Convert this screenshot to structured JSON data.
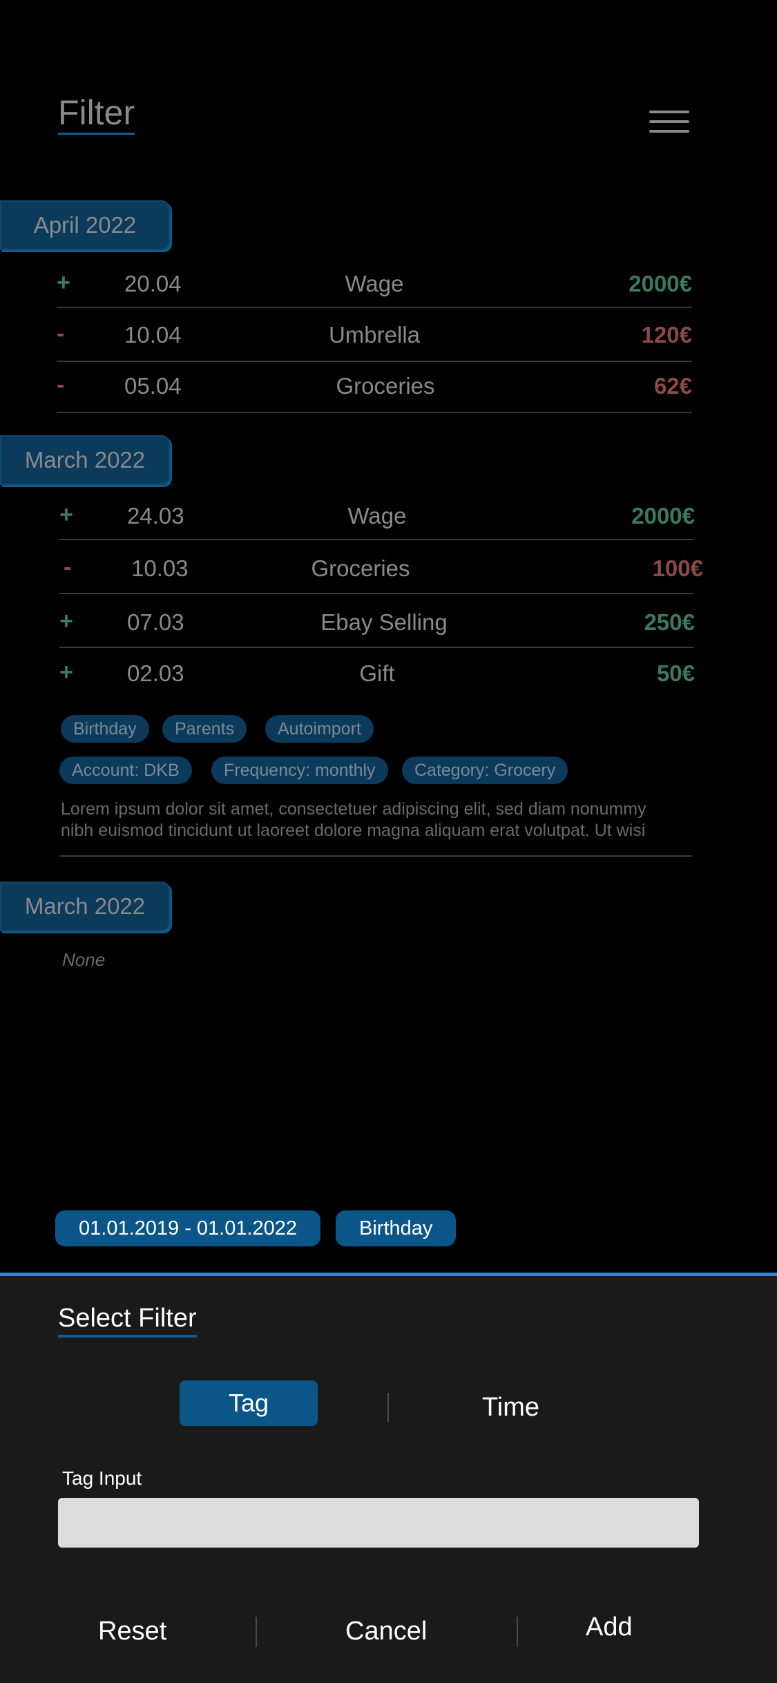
{
  "header": {
    "title": "Filter",
    "menu_icon": "hamburger-menu-icon"
  },
  "months": [
    {
      "label": "April 2022",
      "transactions": [
        {
          "sign": "+",
          "date": "20.04",
          "label": "Wage",
          "amount": "2000€",
          "type": "income"
        },
        {
          "sign": "-",
          "date": "10.04",
          "label": "Umbrella",
          "amount": "120€",
          "type": "expense"
        },
        {
          "sign": "-",
          "date": "05.04",
          "label": "Groceries",
          "amount": "62€",
          "type": "expense"
        }
      ]
    },
    {
      "label": "March 2022",
      "transactions": [
        {
          "sign": "+",
          "date": "24.03",
          "label": "Wage",
          "amount": "2000€",
          "type": "income"
        },
        {
          "sign": "-",
          "date": "10.03",
          "label": "Groceries",
          "amount": "100€",
          "type": "expense"
        },
        {
          "sign": "+",
          "date": "07.03",
          "label": "Ebay Selling",
          "amount": "250€",
          "type": "income"
        },
        {
          "sign": "+",
          "date": "02.03",
          "label": "Gift",
          "amount": "50€",
          "type": "income"
        }
      ],
      "expanded": {
        "tags": [
          "Birthday",
          "Parents",
          "Autoimport"
        ],
        "meta": [
          "Account: DKB",
          "Frequency: monthly",
          "Category: Grocery"
        ],
        "description_line1": "Lorem ipsum dolor sit amet, consectetuer adipiscing elit, sed diam nonummy",
        "description_line2": "nibh euismod tincidunt ut laoreet dolore magna aliquam erat volutpat. Ut wisi"
      }
    },
    {
      "label": "March 2022",
      "empty_text": "None"
    }
  ],
  "active_filters": [
    "01.01.2019 - 01.01.2022",
    "Birthday"
  ],
  "sheet": {
    "title": "Select Filter",
    "tabs": {
      "active": "Tag",
      "other": "Time"
    },
    "input_label": "Tag Input",
    "input_value": "",
    "buttons": {
      "reset": "Reset",
      "cancel": "Cancel",
      "add": "Add"
    }
  },
  "colors": {
    "income": "#3b7a5c",
    "expense": "#8b4a4a",
    "accent": "#0b5688",
    "sheet_border": "#1b8ed4"
  }
}
